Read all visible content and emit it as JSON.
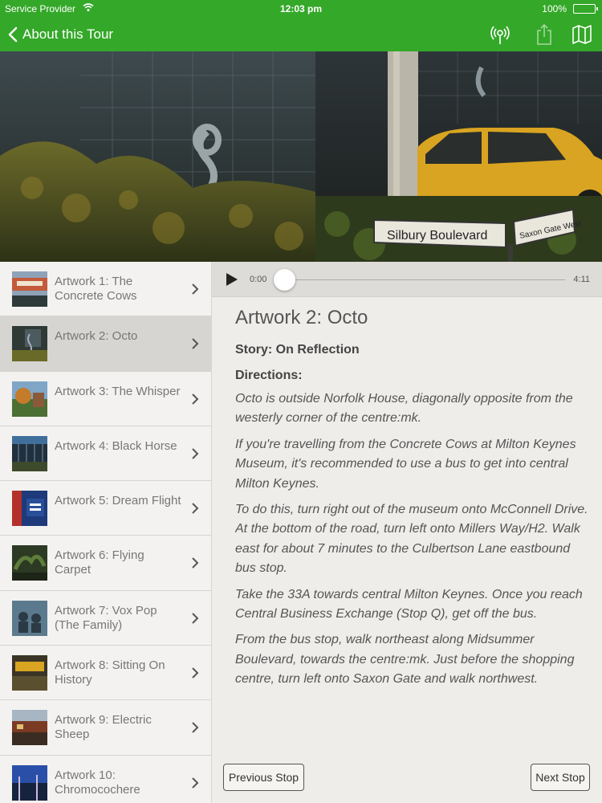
{
  "status_bar": {
    "carrier": "Service Provider",
    "time": "12:03 pm",
    "battery": "100%"
  },
  "nav": {
    "back_label": "About this Tour"
  },
  "stops": [
    {
      "label": "Artwork 1: The Concrete Cows"
    },
    {
      "label": "Artwork 2: Octo"
    },
    {
      "label": "Artwork 3: The Whisper"
    },
    {
      "label": "Artwork 4: Black Horse"
    },
    {
      "label": "Artwork 5: Dream Flight"
    },
    {
      "label": "Artwork 6: Flying Carpet"
    },
    {
      "label": "Artwork 7: Vox Pop (The Family)"
    },
    {
      "label": "Artwork 8: Sitting On History"
    },
    {
      "label": "Artwork 9: Electric Sheep"
    },
    {
      "label": "Artwork 10: Chromocochere"
    }
  ],
  "selected_stop_index": 1,
  "hero": {
    "sign_main": "Silbury Boulevard",
    "sign_side": "Saxon Gate West"
  },
  "player": {
    "current_time": "0:00",
    "total_time": "4:11",
    "progress": 0
  },
  "article": {
    "title": "Artwork 2: Octo",
    "story": "Story: On Reflection",
    "directions_heading": "Directions:",
    "paragraphs": [
      "Octo is outside Norfolk House, diagonally opposite from the westerly corner of the centre:mk.",
      "If you're travelling from the Concrete Cows at Milton Keynes Museum, it's recommended to use a bus to get into central Milton Keynes.",
      "To do this, turn right out of the museum onto McConnell Drive. At the bottom of the road, turn left onto Millers Way/H2. Walk east for about 7 minutes to the Culbertson Lane eastbound bus stop.",
      "Take the 33A towards central Milton Keynes. Once you reach Central Business Exchange (Stop Q), get off the bus.",
      "From the bus stop, walk northeast along Midsummer Boulevard, towards the centre:mk. Just before the shopping centre, turn left onto Saxon Gate and walk northwest."
    ]
  },
  "footer": {
    "previous": "Previous Stop",
    "next": "Next Stop"
  },
  "colors": {
    "brand_green": "#34a829",
    "background": "#efedea"
  }
}
